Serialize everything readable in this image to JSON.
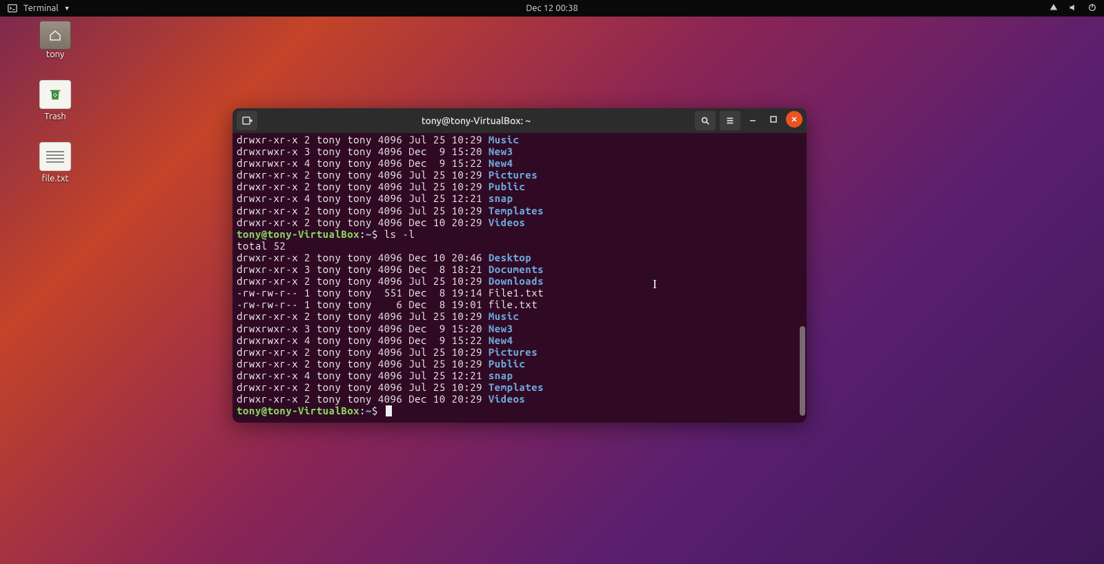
{
  "topbar": {
    "app_label": "Terminal",
    "clock": "Dec 12  00:38"
  },
  "desktop": {
    "home_label": "tony",
    "trash_label": "Trash",
    "file_label": "file.txt"
  },
  "terminal": {
    "title": "tony@tony-VirtualBox: ~",
    "prompt_user": "tony@tony-VirtualBox",
    "prompt_sep": ":",
    "prompt_path": "~",
    "prompt_end": "$",
    "listing1": [
      {
        "perms": "drwxr-xr-x",
        "n": "2",
        "u": "tony",
        "g": "tony",
        "sz": "4096",
        "date": "Jul 25 10:29",
        "name": "Music",
        "dir": true
      },
      {
        "perms": "drwxrwxr-x",
        "n": "3",
        "u": "tony",
        "g": "tony",
        "sz": "4096",
        "date": "Dec  9 15:20",
        "name": "New3",
        "dir": true
      },
      {
        "perms": "drwxrwxr-x",
        "n": "4",
        "u": "tony",
        "g": "tony",
        "sz": "4096",
        "date": "Dec  9 15:22",
        "name": "New4",
        "dir": true
      },
      {
        "perms": "drwxr-xr-x",
        "n": "2",
        "u": "tony",
        "g": "tony",
        "sz": "4096",
        "date": "Jul 25 10:29",
        "name": "Pictures",
        "dir": true
      },
      {
        "perms": "drwxr-xr-x",
        "n": "2",
        "u": "tony",
        "g": "tony",
        "sz": "4096",
        "date": "Jul 25 10:29",
        "name": "Public",
        "dir": true
      },
      {
        "perms": "drwxr-xr-x",
        "n": "4",
        "u": "tony",
        "g": "tony",
        "sz": "4096",
        "date": "Jul 25 12:21",
        "name": "snap",
        "dir": true
      },
      {
        "perms": "drwxr-xr-x",
        "n": "2",
        "u": "tony",
        "g": "tony",
        "sz": "4096",
        "date": "Jul 25 10:29",
        "name": "Templates",
        "dir": true
      },
      {
        "perms": "drwxr-xr-x",
        "n": "2",
        "u": "tony",
        "g": "tony",
        "sz": "4096",
        "date": "Dec 10 20:29",
        "name": "Videos",
        "dir": true
      }
    ],
    "command1": "ls -l",
    "total_line": "total 52",
    "listing2": [
      {
        "perms": "drwxr-xr-x",
        "n": "2",
        "u": "tony",
        "g": "tony",
        "sz": "4096",
        "date": "Dec 10 20:46",
        "name": "Desktop",
        "dir": true
      },
      {
        "perms": "drwxr-xr-x",
        "n": "3",
        "u": "tony",
        "g": "tony",
        "sz": "4096",
        "date": "Dec  8 18:21",
        "name": "Documents",
        "dir": true
      },
      {
        "perms": "drwxr-xr-x",
        "n": "2",
        "u": "tony",
        "g": "tony",
        "sz": "4096",
        "date": "Jul 25 10:29",
        "name": "Downloads",
        "dir": true
      },
      {
        "perms": "-rw-rw-r--",
        "n": "1",
        "u": "tony",
        "g": "tony",
        "sz": " 551",
        "date": "Dec  8 19:14",
        "name": "File1.txt",
        "dir": false
      },
      {
        "perms": "-rw-rw-r--",
        "n": "1",
        "u": "tony",
        "g": "tony",
        "sz": "   6",
        "date": "Dec  8 19:01",
        "name": "file.txt",
        "dir": false
      },
      {
        "perms": "drwxr-xr-x",
        "n": "2",
        "u": "tony",
        "g": "tony",
        "sz": "4096",
        "date": "Jul 25 10:29",
        "name": "Music",
        "dir": true
      },
      {
        "perms": "drwxrwxr-x",
        "n": "3",
        "u": "tony",
        "g": "tony",
        "sz": "4096",
        "date": "Dec  9 15:20",
        "name": "New3",
        "dir": true
      },
      {
        "perms": "drwxrwxr-x",
        "n": "4",
        "u": "tony",
        "g": "tony",
        "sz": "4096",
        "date": "Dec  9 15:22",
        "name": "New4",
        "dir": true
      },
      {
        "perms": "drwxr-xr-x",
        "n": "2",
        "u": "tony",
        "g": "tony",
        "sz": "4096",
        "date": "Jul 25 10:29",
        "name": "Pictures",
        "dir": true
      },
      {
        "perms": "drwxr-xr-x",
        "n": "2",
        "u": "tony",
        "g": "tony",
        "sz": "4096",
        "date": "Jul 25 10:29",
        "name": "Public",
        "dir": true
      },
      {
        "perms": "drwxr-xr-x",
        "n": "4",
        "u": "tony",
        "g": "tony",
        "sz": "4096",
        "date": "Jul 25 12:21",
        "name": "snap",
        "dir": true
      },
      {
        "perms": "drwxr-xr-x",
        "n": "2",
        "u": "tony",
        "g": "tony",
        "sz": "4096",
        "date": "Jul 25 10:29",
        "name": "Templates",
        "dir": true
      },
      {
        "perms": "drwxr-xr-x",
        "n": "2",
        "u": "tony",
        "g": "tony",
        "sz": "4096",
        "date": "Dec 10 20:29",
        "name": "Videos",
        "dir": true
      }
    ]
  }
}
